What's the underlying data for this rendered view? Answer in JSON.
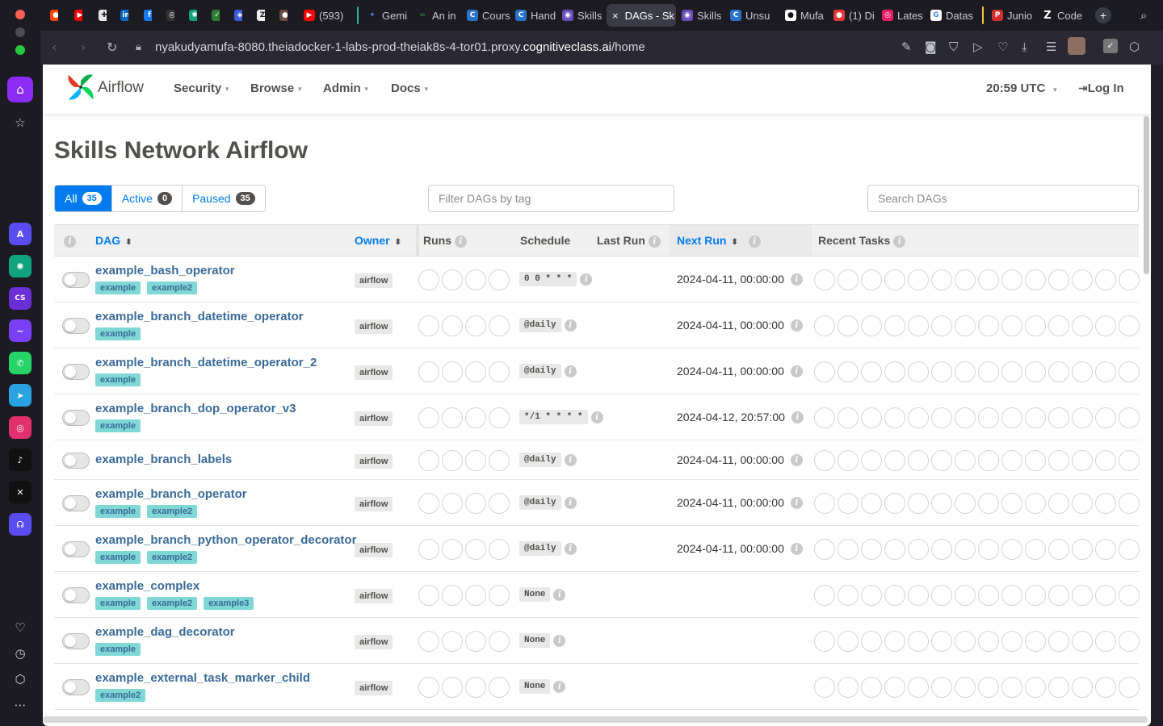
{
  "browser": {
    "tabs": [
      {
        "label": "(593)",
        "icon": "youtube-icon",
        "color": "#ff0000"
      },
      {
        "label": "Gemi",
        "icon": "gemini-icon",
        "color": "#4285f4"
      },
      {
        "label": "An in",
        "icon": "infinity-icon",
        "color": "#2e7d32"
      },
      {
        "label": "Cours",
        "icon": "coursera-icon",
        "color": "#2a73cc"
      },
      {
        "label": "Hand",
        "icon": "coursera-icon",
        "color": "#2a73cc"
      },
      {
        "label": "Skills",
        "icon": "skills-icon",
        "color": "#6b4fbb"
      },
      {
        "label": "DAGs - Sk",
        "icon": "close-icon",
        "color": "#3b3a47"
      },
      {
        "label": "Skills",
        "icon": "skills-icon",
        "color": "#6b4fbb"
      },
      {
        "label": "Unsu",
        "icon": "coursera-icon",
        "color": "#2a73cc"
      },
      {
        "label": "Mufa",
        "icon": "github-icon",
        "color": "#24292e"
      },
      {
        "label": "(1) Di",
        "icon": "discord-icon",
        "color": "#e53935"
      },
      {
        "label": "Lates",
        "icon": "lates-icon",
        "color": "#e91e63"
      },
      {
        "label": "Datas",
        "icon": "google-icon",
        "color": "#4285f4"
      },
      {
        "label": "Junio",
        "icon": "p-icon",
        "color": "#d32f2f"
      },
      {
        "label": "Code",
        "icon": "z-icon",
        "color": "#222222"
      }
    ],
    "url_prefix": "nyakudyamufa-8080.theiadocker-1-labs-prod-theiak8s-4-tor01.proxy.",
    "url_host": "cognitiveclass.ai",
    "url_path": "/home"
  },
  "navbar": {
    "brand": "Airflow",
    "menus": [
      "Security",
      "Browse",
      "Admin",
      "Docs"
    ],
    "clock": "20:59 UTC",
    "login": "Log In"
  },
  "page": {
    "title": "Skills Network Airflow",
    "filters": {
      "all_label": "All",
      "all_count": "35",
      "active_label": "Active",
      "active_count": "0",
      "paused_label": "Paused",
      "paused_count": "35"
    },
    "tag_filter_placeholder": "Filter DAGs by tag",
    "search_placeholder": "Search DAGs"
  },
  "table": {
    "columns": {
      "dag": "DAG",
      "owner": "Owner",
      "runs": "Runs",
      "schedule": "Schedule",
      "last_run": "Last Run",
      "next_run": "Next Run",
      "recent_tasks": "Recent Tasks"
    },
    "rows": [
      {
        "name": "example_bash_operator",
        "tags": [
          "example",
          "example2"
        ],
        "owner": "airflow",
        "schedule": "0 0 * * *",
        "next_run": "2024-04-11, 00:00:00"
      },
      {
        "name": "example_branch_datetime_operator",
        "tags": [
          "example"
        ],
        "owner": "airflow",
        "schedule": "@daily",
        "next_run": "2024-04-11, 00:00:00"
      },
      {
        "name": "example_branch_datetime_operator_2",
        "tags": [
          "example"
        ],
        "owner": "airflow",
        "schedule": "@daily",
        "next_run": "2024-04-11, 00:00:00"
      },
      {
        "name": "example_branch_dop_operator_v3",
        "tags": [
          "example"
        ],
        "owner": "airflow",
        "schedule": "*/1 * * * *",
        "next_run": "2024-04-12, 20:57:00"
      },
      {
        "name": "example_branch_labels",
        "tags": [],
        "owner": "airflow",
        "schedule": "@daily",
        "next_run": "2024-04-11, 00:00:00"
      },
      {
        "name": "example_branch_operator",
        "tags": [
          "example",
          "example2"
        ],
        "owner": "airflow",
        "schedule": "@daily",
        "next_run": "2024-04-11, 00:00:00"
      },
      {
        "name": "example_branch_python_operator_decorator",
        "tags": [
          "example",
          "example2"
        ],
        "owner": "airflow",
        "schedule": "@daily",
        "next_run": "2024-04-11, 00:00:00"
      },
      {
        "name": "example_complex",
        "tags": [
          "example",
          "example2",
          "example3"
        ],
        "owner": "airflow",
        "schedule": "None",
        "next_run": ""
      },
      {
        "name": "example_dag_decorator",
        "tags": [
          "example"
        ],
        "owner": "airflow",
        "schedule": "None",
        "next_run": ""
      },
      {
        "name": "example_external_task_marker_child",
        "tags": [
          "example2"
        ],
        "owner": "airflow",
        "schedule": "None",
        "next_run": ""
      }
    ]
  },
  "colors": {
    "accent": "#017cee",
    "dag_link": "#3a6b97",
    "tag_bg": "#7fd8d6",
    "text": "#51504f"
  }
}
